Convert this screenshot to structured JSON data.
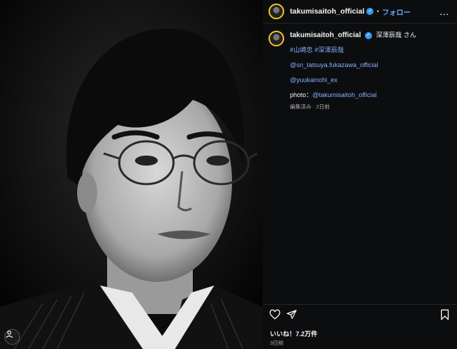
{
  "post": {
    "image_alt_icon": "tagged-user-icon"
  },
  "header": {
    "username": "takumisaitoh_official",
    "separator": "•",
    "follow_label": "フォロー",
    "more_label": "…"
  },
  "caption": {
    "username": "takumisaitoh_official",
    "text": "深澤辰哉 さん",
    "hashtags": "#山崎忠 #深澤辰哉",
    "mention1": "@sn_tatsuya.fukazawa_official",
    "mention2": "@yuukainohi_ex",
    "photo_prefix": "photo：",
    "photo_credit": "@takumisaitoh_official",
    "meta": "編集済み · 2日前"
  },
  "footer": {
    "likes": "いいね！7.2万件",
    "date": "3日前"
  },
  "icons": {
    "like": "heart-icon",
    "share": "send-icon",
    "save": "bookmark-icon"
  },
  "colors": {
    "link": "#84aefb",
    "follow": "#62a8ff",
    "verified": "#3897f0",
    "panel_bg": "#0c0d0f"
  }
}
